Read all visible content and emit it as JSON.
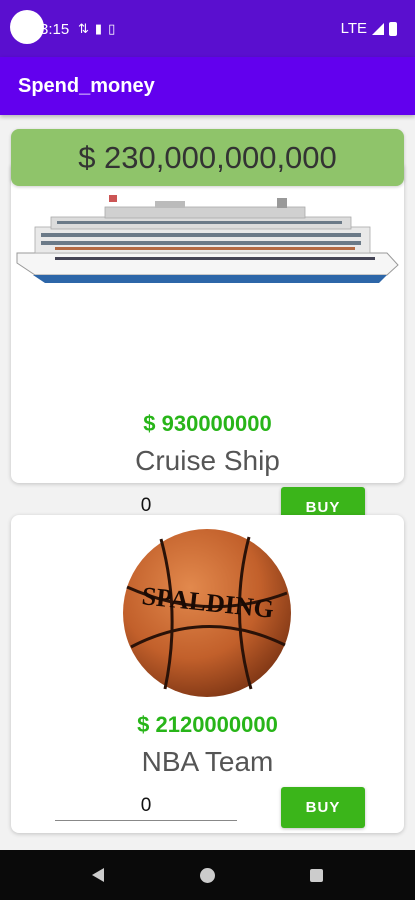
{
  "status_bar": {
    "time": "3:15",
    "network": "LTE",
    "left_icons": [
      "sync-icon",
      "sim-icon",
      "storage-icon"
    ]
  },
  "app_bar": {
    "title": "Spend_money"
  },
  "balance": {
    "text": "$ 230,000,000,000"
  },
  "items": [
    {
      "image_icon": "cruise-ship-image",
      "price": "$ 930000000",
      "name": "Cruise Ship",
      "quantity": "0",
      "buy_label": "BUY"
    },
    {
      "image_icon": "basketball-image",
      "price": "$ 2120000000",
      "name": "NBA Team",
      "quantity": "0",
      "buy_label": "BUY"
    }
  ],
  "colors": {
    "status_bar": "#5a0fcf",
    "app_bar": "#6200ee",
    "balance_bg": "#8fc46a",
    "price_text": "#28b519",
    "buy_button": "#3bb51a"
  }
}
